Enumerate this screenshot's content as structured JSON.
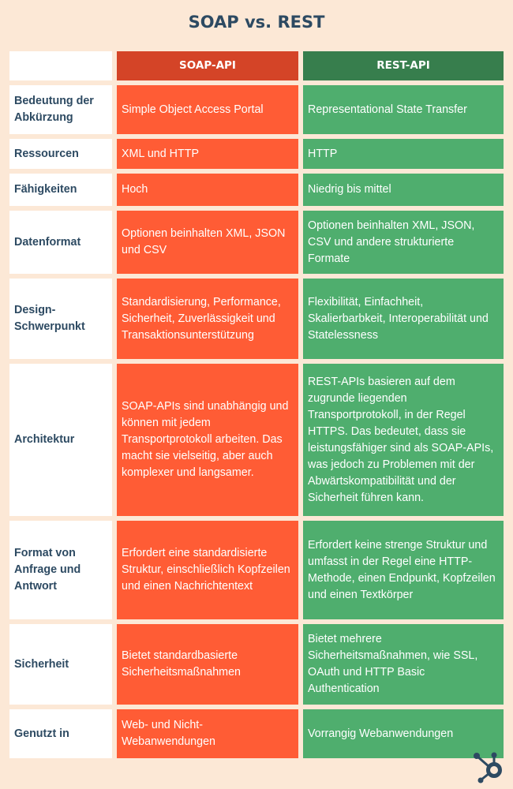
{
  "title": "SOAP vs. REST",
  "header": {
    "blank": "",
    "soap": "SOAP-API",
    "rest": "REST-API"
  },
  "colors": {
    "soap_header": "#d44427",
    "soap_cell": "#ff5c35",
    "rest_header": "#377e4d",
    "rest_cell": "#4fae6e",
    "label_text": "#2d4a62",
    "background": "#fce8d6"
  },
  "rows": [
    {
      "label": "Bedeutung der Abkürzung",
      "soap": "Simple Object Access Portal",
      "rest": "Representational State Transfer"
    },
    {
      "label": "Ressourcen",
      "soap": "XML und HTTP",
      "rest": "HTTP"
    },
    {
      "label": "Fähigkeiten",
      "soap": "Hoch",
      "rest": "Niedrig bis mittel"
    },
    {
      "label": "Datenformat",
      "soap": "Optionen beinhalten XML, JSON und CSV",
      "rest": "Optionen beinhalten XML, JSON, CSV und andere strukturierte Formate"
    },
    {
      "label": "Design-Schwerpunkt",
      "soap": "Standardisierung, Performance, Sicherheit, Zuverlässigkeit und Transaktionsunterstützung",
      "rest": "Flexibilität, Einfachheit, Skalierbarbkeit, Interoperabilität und Statelessness"
    },
    {
      "label": "Architektur",
      "soap": "SOAP-APIs sind unabhängig und können mit jedem Transportprotokoll arbeiten. Das macht sie vielseitig, aber auch komplexer und langsamer.",
      "rest": "REST-APIs basieren auf dem zugrunde liegenden Transportprotokoll, in der Regel HTTPS. Das bedeutet, dass sie leistungsfähiger sind als SOAP-APIs, was jedoch zu Problemen mit der Abwärtskompatibilität und der Sicherheit führen kann."
    },
    {
      "label": "Format von Anfrage und Antwort",
      "soap": "Erfordert eine standardisierte Struktur, einschließlich Kopfzeilen und einen Nachrichtentext",
      "rest": "Erfordert keine strenge Struktur und umfasst in der Regel eine HTTP-Methode, einen Endpunkt, Kopfzeilen und einen Textkörper"
    },
    {
      "label": "Sicherheit",
      "soap": "Bietet standardbasierte Sicherheitsmaßnahmen",
      "rest": "Bietet mehrere Sicherheitsmaßnahmen, wie SSL, OAuth und HTTP Basic Authentication"
    },
    {
      "label": "Genutzt in",
      "soap": "Web- und Nicht-Webanwendungen",
      "rest": "Vorrangig Webanwendungen"
    }
  ],
  "logo": {
    "icon": "hubspot-sprocket-icon"
  }
}
